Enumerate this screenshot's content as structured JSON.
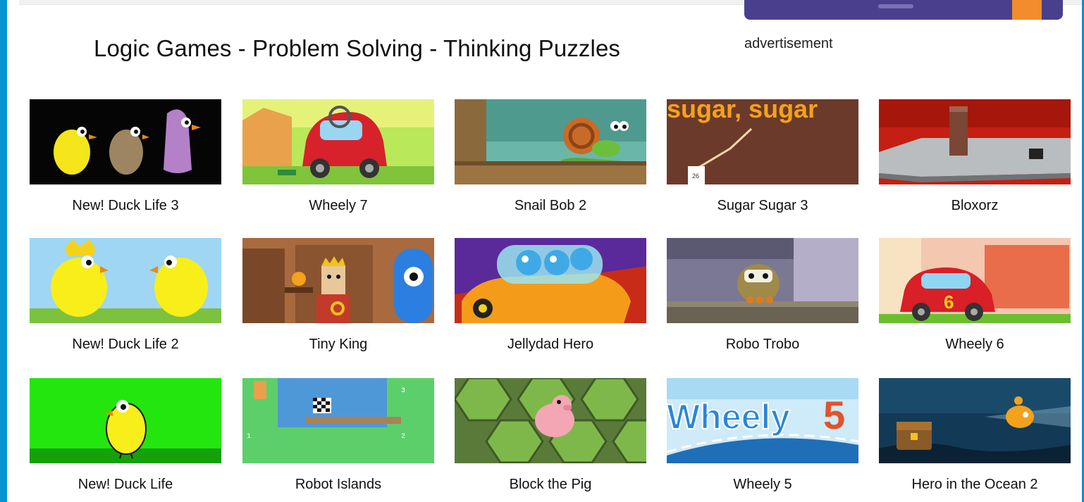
{
  "page": {
    "title": "Logic Games - Problem Solving - Thinking Puzzles",
    "ad_label": "advertisement"
  },
  "colors": {
    "frame": "#0693d1",
    "ad_bar": "#4a3f8c",
    "ad_button": "#f28c2c"
  },
  "games": [
    {
      "name": "New! Duck Life 3",
      "icon": "duck-life-3-thumbnail"
    },
    {
      "name": "Wheely 7",
      "icon": "wheely-7-thumbnail"
    },
    {
      "name": "Snail Bob 2",
      "icon": "snail-bob-2-thumbnail"
    },
    {
      "name": "Sugar Sugar 3",
      "icon": "sugar-sugar-3-thumbnail",
      "thumb_text": "sugar, sugar",
      "thumb_number": "26"
    },
    {
      "name": "Bloxorz",
      "icon": "bloxorz-thumbnail"
    },
    {
      "name": "New! Duck Life 2",
      "icon": "duck-life-2-thumbnail"
    },
    {
      "name": "Tiny King",
      "icon": "tiny-king-thumbnail"
    },
    {
      "name": "Jellydad Hero",
      "icon": "jellydad-hero-thumbnail"
    },
    {
      "name": "Robo Trobo",
      "icon": "robo-trobo-thumbnail"
    },
    {
      "name": "Wheely 6",
      "icon": "wheely-6-thumbnail",
      "thumb_number": "6"
    },
    {
      "name": "New! Duck Life",
      "icon": "duck-life-thumbnail"
    },
    {
      "name": "Robot Islands",
      "icon": "robot-islands-thumbnail",
      "thumb_numbers": [
        "3",
        "2",
        "1"
      ]
    },
    {
      "name": "Block the Pig",
      "icon": "block-the-pig-thumbnail"
    },
    {
      "name": "Wheely 5",
      "icon": "wheely-5-thumbnail",
      "thumb_text": "Wheely",
      "thumb_number": "5"
    },
    {
      "name": "Hero in the Ocean 2",
      "icon": "hero-in-the-ocean-2-thumbnail"
    }
  ]
}
